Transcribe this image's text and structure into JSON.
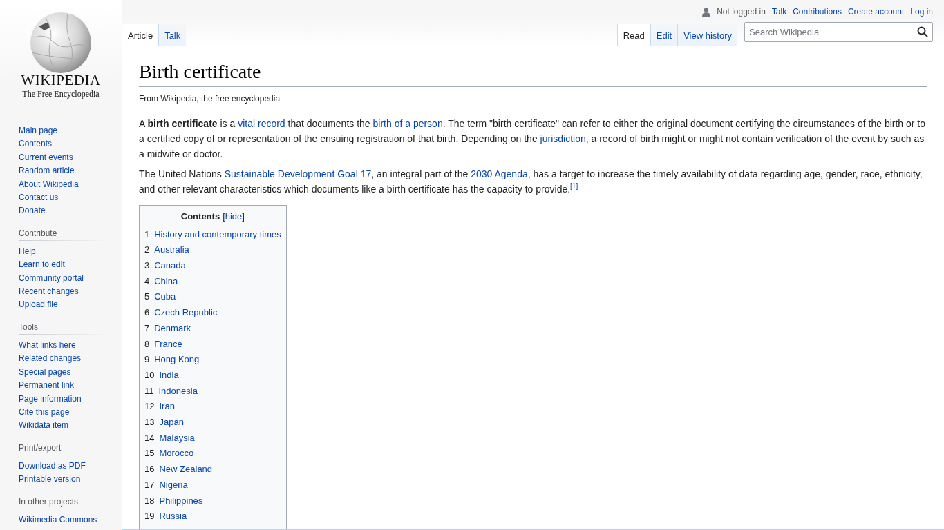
{
  "logo": {
    "wordmark": "WIKIPEDIA",
    "tagline": "The Free Encyclopedia"
  },
  "personal": {
    "status": "Not logged in",
    "links": [
      "Talk",
      "Contributions",
      "Create account",
      "Log in"
    ]
  },
  "namespace_tabs": [
    {
      "label": "Article",
      "selected": true
    },
    {
      "label": "Talk",
      "selected": false
    }
  ],
  "view_tabs": [
    {
      "label": "Read",
      "selected": true
    },
    {
      "label": "Edit",
      "selected": false
    },
    {
      "label": "View history",
      "selected": false
    }
  ],
  "search": {
    "placeholder": "Search Wikipedia"
  },
  "sidebar": [
    {
      "items": [
        "Main page",
        "Contents",
        "Current events",
        "Random article",
        "About Wikipedia",
        "Contact us",
        "Donate"
      ]
    },
    {
      "heading": "Contribute",
      "items": [
        "Help",
        "Learn to edit",
        "Community portal",
        "Recent changes",
        "Upload file"
      ]
    },
    {
      "heading": "Tools",
      "items": [
        "What links here",
        "Related changes",
        "Special pages",
        "Permanent link",
        "Page information",
        "Cite this page",
        "Wikidata item"
      ]
    },
    {
      "heading": "Print/export",
      "items": [
        "Download as PDF",
        "Printable version"
      ]
    },
    {
      "heading": "In other projects",
      "items": [
        "Wikimedia Commons"
      ]
    }
  ],
  "article": {
    "title": "Birth certificate",
    "tagline": "From Wikipedia, the free encyclopedia",
    "paragraphs": [
      [
        {
          "kind": "text",
          "text": "A "
        },
        {
          "kind": "bold",
          "text": "birth certificate"
        },
        {
          "kind": "text",
          "text": " is a "
        },
        {
          "kind": "link",
          "text": "vital record"
        },
        {
          "kind": "text",
          "text": " that documents the "
        },
        {
          "kind": "link",
          "text": "birth of a person"
        },
        {
          "kind": "text",
          "text": ". The term \"birth certificate\" can refer to either the original document certifying the circumstances of the birth or to a certified copy of or representation of the ensuing registration of that birth. Depending on the "
        },
        {
          "kind": "link",
          "text": "jurisdiction"
        },
        {
          "kind": "text",
          "text": ", a record of birth might or might not contain verification of the event by such as a midwife or doctor."
        }
      ],
      [
        {
          "kind": "text",
          "text": "The United Nations "
        },
        {
          "kind": "link",
          "text": "Sustainable Development Goal 17"
        },
        {
          "kind": "text",
          "text": ", an integral part of the "
        },
        {
          "kind": "link",
          "text": "2030 Agenda"
        },
        {
          "kind": "text",
          "text": ", has a target to increase the timely availability of data regarding age, gender, race, ethnicity, and other relevant characteristics which documents like a birth certificate has the capacity to provide."
        },
        {
          "kind": "ref",
          "text": "[1]"
        }
      ]
    ]
  },
  "toc": {
    "title": "Contents",
    "toggle_open": "[",
    "toggle": "hide",
    "toggle_close": "]",
    "items": [
      {
        "number": "1",
        "label": "History and contemporary times"
      },
      {
        "number": "2",
        "label": "Australia"
      },
      {
        "number": "3",
        "label": "Canada"
      },
      {
        "number": "4",
        "label": "China"
      },
      {
        "number": "5",
        "label": "Cuba"
      },
      {
        "number": "6",
        "label": "Czech Republic"
      },
      {
        "number": "7",
        "label": "Denmark"
      },
      {
        "number": "8",
        "label": "France"
      },
      {
        "number": "9",
        "label": "Hong Kong"
      },
      {
        "number": "10",
        "label": "India"
      },
      {
        "number": "11",
        "label": "Indonesia"
      },
      {
        "number": "12",
        "label": "Iran"
      },
      {
        "number": "13",
        "label": "Japan"
      },
      {
        "number": "14",
        "label": "Malaysia"
      },
      {
        "number": "15",
        "label": "Morocco"
      },
      {
        "number": "16",
        "label": "New Zealand"
      },
      {
        "number": "17",
        "label": "Nigeria"
      },
      {
        "number": "18",
        "label": "Philippines"
      },
      {
        "number": "19",
        "label": "Russia"
      }
    ]
  }
}
